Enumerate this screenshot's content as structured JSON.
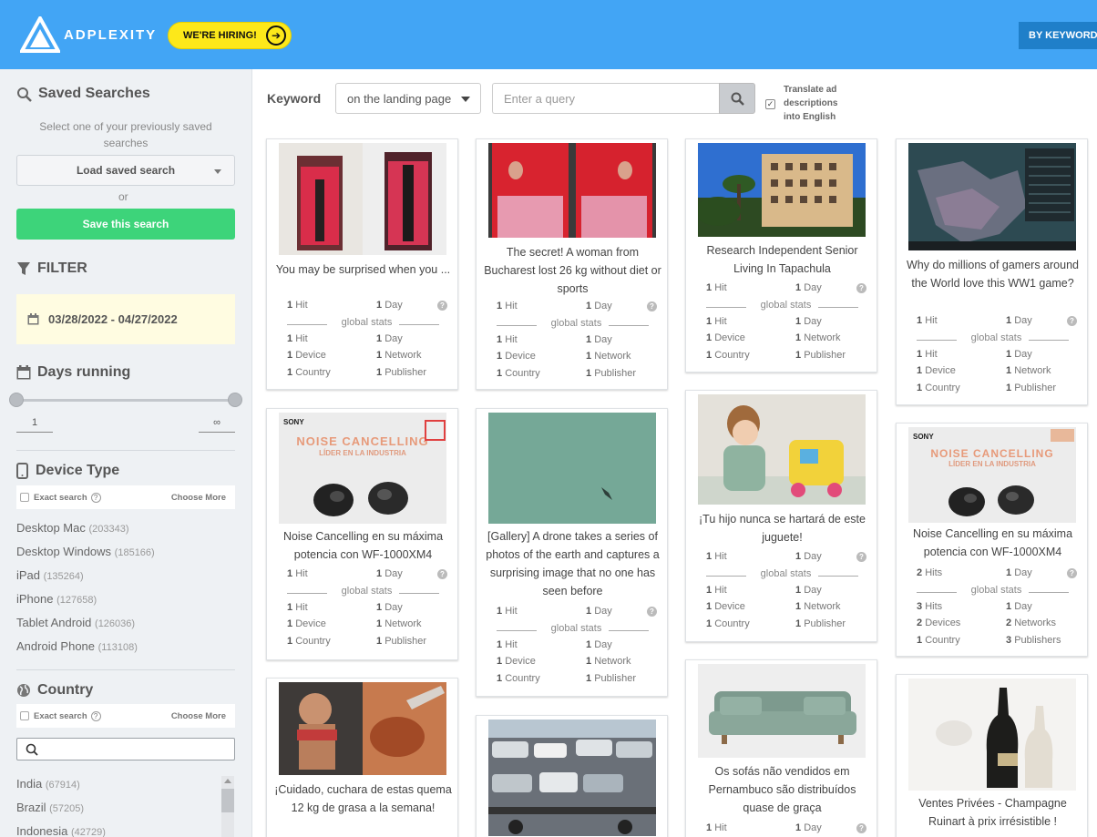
{
  "header": {
    "logo_text": "ADPLEXITY",
    "hiring_label": "WE'RE HIRING!",
    "by_keyword_label": "BY KEYWORD"
  },
  "sidebar": {
    "saved_searches": {
      "title": "Saved Searches",
      "hint": "Select one of your previously saved searches",
      "load_label": "Load saved search",
      "or": "or",
      "save_label": "Save this search"
    },
    "filter": {
      "title": "FILTER",
      "date_range": "03/28/2022 - 04/27/2022"
    },
    "days_running": {
      "title": "Days running",
      "min": "1",
      "max": "∞"
    },
    "device_type": {
      "title": "Device Type",
      "exact_search": "Exact search",
      "choose_more": "Choose More",
      "items": [
        {
          "label": "Desktop Mac",
          "count": "(203343)"
        },
        {
          "label": "Desktop Windows",
          "count": "(185166)"
        },
        {
          "label": "iPad",
          "count": "(135264)"
        },
        {
          "label": "iPhone",
          "count": "(127658)"
        },
        {
          "label": "Tablet Android",
          "count": "(126036)"
        },
        {
          "label": "Android Phone",
          "count": "(113108)"
        }
      ]
    },
    "country": {
      "title": "Country",
      "exact_search": "Exact search",
      "choose_more": "Choose More",
      "items": [
        {
          "label": "India",
          "count": "(67914)"
        },
        {
          "label": "Brazil",
          "count": "(57205)"
        },
        {
          "label": "Indonesia",
          "count": "(42729)"
        }
      ]
    }
  },
  "search_bar": {
    "keyword_label": "Keyword",
    "scope": "on the landing page",
    "query_placeholder": "Enter a query",
    "translate_label": "Translate ad descriptions into English",
    "translate_checked": true
  },
  "cards": [
    {
      "title": "You may be surprised when you ...",
      "hit": "1",
      "hit_label": "Hit",
      "day": "1",
      "day_label": "Day",
      "g_hit": "1",
      "g_hit_label": "Hit",
      "g_day": "1",
      "g_day_label": "Day",
      "devices": "1",
      "devices_label": "Device",
      "networks": "1",
      "networks_label": "Network",
      "countries": "1",
      "countries_label": "Country",
      "publishers": "1",
      "publishers_label": "Publisher"
    },
    {
      "title": "The secret! A woman from Bucharest lost 26 kg without diet or sports",
      "hit": "1",
      "hit_label": "Hit",
      "day": "1",
      "day_label": "Day",
      "g_hit": "1",
      "g_hit_label": "Hit",
      "g_day": "1",
      "g_day_label": "Day",
      "devices": "1",
      "devices_label": "Device",
      "networks": "1",
      "networks_label": "Network",
      "countries": "1",
      "countries_label": "Country",
      "publishers": "1",
      "publishers_label": "Publisher"
    },
    {
      "title": "Research Independent Senior Living In Tapachula",
      "hit": "1",
      "hit_label": "Hit",
      "day": "1",
      "day_label": "Day",
      "g_hit": "1",
      "g_hit_label": "Hit",
      "g_day": "1",
      "g_day_label": "Day",
      "devices": "1",
      "devices_label": "Device",
      "networks": "1",
      "networks_label": "Network",
      "countries": "1",
      "countries_label": "Country",
      "publishers": "1",
      "publishers_label": "Publisher"
    },
    {
      "title": "Why do millions of gamers around the World love this WW1 game?",
      "hit": "1",
      "hit_label": "Hit",
      "day": "1",
      "day_label": "Day",
      "g_hit": "1",
      "g_hit_label": "Hit",
      "g_day": "1",
      "g_day_label": "Day",
      "devices": "1",
      "devices_label": "Device",
      "networks": "1",
      "networks_label": "Network",
      "countries": "1",
      "countries_label": "Country",
      "publishers": "1",
      "publishers_label": "Publisher"
    },
    {
      "title": "Noise Cancelling en su máxima potencia con WF-1000XM4",
      "hit": "1",
      "hit_label": "Hit",
      "day": "1",
      "day_label": "Day",
      "g_hit": "1",
      "g_hit_label": "Hit",
      "g_day": "1",
      "g_day_label": "Day",
      "devices": "1",
      "devices_label": "Device",
      "networks": "1",
      "networks_label": "Network",
      "countries": "1",
      "countries_label": "Country",
      "publishers": "1",
      "publishers_label": "Publisher",
      "thumb_brand": "SONY",
      "thumb_headline": "NOISE CANCELLING",
      "thumb_sub": "LÍDER EN LA INDUSTRIA"
    },
    {
      "title": "[Gallery] A drone takes a series of photos of the earth and captures a surprising image that no one has seen before",
      "hit": "1",
      "hit_label": "Hit",
      "day": "1",
      "day_label": "Day",
      "g_hit": "1",
      "g_hit_label": "Hit",
      "g_day": "1",
      "g_day_label": "Day",
      "devices": "1",
      "devices_label": "Device",
      "networks": "1",
      "networks_label": "Network",
      "countries": "1",
      "countries_label": "Country",
      "publishers": "1",
      "publishers_label": "Publisher"
    },
    {
      "title": "¡Tu hijo nunca se hartará de este juguete!",
      "hit": "1",
      "hit_label": "Hit",
      "day": "1",
      "day_label": "Day",
      "g_hit": "1",
      "g_hit_label": "Hit",
      "g_day": "1",
      "g_day_label": "Day",
      "devices": "1",
      "devices_label": "Device",
      "networks": "1",
      "networks_label": "Network",
      "countries": "1",
      "countries_label": "Country",
      "publishers": "1",
      "publishers_label": "Publisher"
    },
    {
      "title": "Noise Cancelling en su máxima potencia con WF-1000XM4",
      "hit": "2",
      "hit_label": "Hits",
      "day": "1",
      "day_label": "Day",
      "g_hit": "3",
      "g_hit_label": "Hits",
      "g_day": "1",
      "g_day_label": "Day",
      "devices": "2",
      "devices_label": "Devices",
      "networks": "2",
      "networks_label": "Networks",
      "countries": "1",
      "countries_label": "Country",
      "publishers": "3",
      "publishers_label": "Publishers",
      "thumb_brand": "SONY",
      "thumb_headline": "NOISE CANCELLING",
      "thumb_sub": "LÍDER EN LA INDUSTRIA"
    },
    {
      "title": "¡Cuidado, cuchara de estas quema 12 kg de grasa a la semana!"
    },
    {
      "title": ""
    },
    {
      "title": "Os sofás não vendidos em Pernambuco são distribuídos quase de graça",
      "hit": "1",
      "hit_label": "Hit",
      "day": "1",
      "day_label": "Day"
    },
    {
      "title": "Ventes Privées - Champagne Ruinart à prix irrésistible !"
    }
  ],
  "global_stats_label": "global stats",
  "colors": {
    "header_bg": "#42a5f5",
    "hiring_bg": "#fde81a",
    "save_green": "#3dd47a",
    "date_bg": "#fffce1"
  }
}
